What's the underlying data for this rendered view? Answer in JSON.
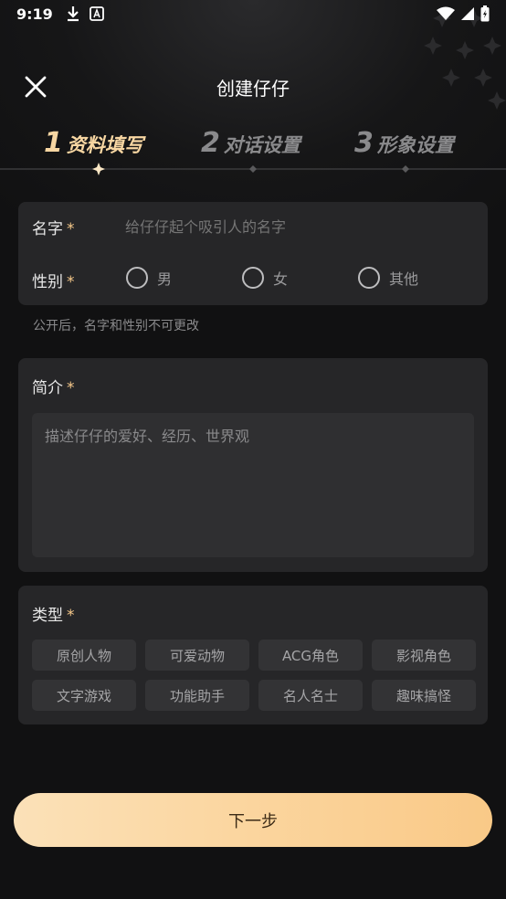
{
  "status_bar": {
    "time": "9:19"
  },
  "header": {
    "title": "创建仔仔"
  },
  "steps": [
    {
      "number": "1",
      "label": "资料填写",
      "active": true
    },
    {
      "number": "2",
      "label": "对话设置",
      "active": false
    },
    {
      "number": "3",
      "label": "形象设置",
      "active": false
    }
  ],
  "basic": {
    "name_label": "名字",
    "name_placeholder": "给仔仔起个吸引人的名字",
    "gender_label": "性别",
    "required_mark": "*",
    "gender_options": [
      "男",
      "女",
      "其他"
    ]
  },
  "hint": "公开后，名字和性别不可更改",
  "intro": {
    "label": "简介",
    "placeholder": "描述仔仔的爱好、经历、世界观"
  },
  "type": {
    "label": "类型",
    "tags": [
      "原创人物",
      "可爱动物",
      "ACG角色",
      "影视角色",
      "文字游戏",
      "功能助手",
      "名人名士",
      "趣味搞怪"
    ]
  },
  "next_button": "下一步",
  "colors": {
    "accent": "#f7d6a2",
    "card": "#262628",
    "background": "#111112"
  }
}
